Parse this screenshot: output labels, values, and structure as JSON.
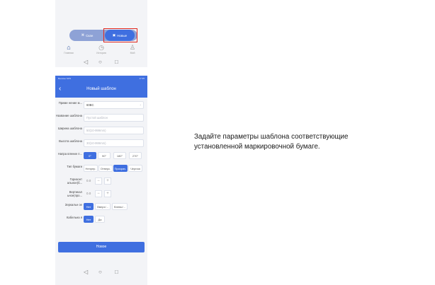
{
  "top_screen": {
    "segments": [
      {
        "label": "Скан",
        "icon": "scan-icon"
      },
      {
        "label": "Новые",
        "icon": "new-template-icon"
      }
    ],
    "tabs": [
      {
        "label": "Главная",
        "icon": "home-icon"
      },
      {
        "label": "История",
        "icon": "clock-icon"
      },
      {
        "label": "Мой",
        "icon": "user-icon"
      }
    ],
    "nav": {
      "back": "◁",
      "home": "○",
      "recent": "□"
    },
    "highlight_color": "#e0261c"
  },
  "main_screen": {
    "status_left": "Вызовы SOS",
    "status_right": "17:35",
    "title": "Новый шаблон",
    "back_glyph": "‹",
    "fields": {
      "name_example": {
        "label": "Приме нение м...",
        "value": "60BC"
      },
      "template_name": {
        "label": "Название шаблона",
        "placeholder": "Пустой шаблон"
      },
      "width": {
        "label": "Ширина шаблона",
        "placeholder": "50(10-999mm)"
      },
      "height": {
        "label": "Высота шаблона",
        "placeholder": "30(10-999mm)"
      }
    },
    "direction": {
      "label": "Напра вление п...",
      "options": [
        "0°",
        "90°",
        "180°",
        "270°"
      ],
      "selected": 0
    },
    "paper_type": {
      "label": "Тип бумаги",
      "options": [
        "Непрер.",
        "Отверс.",
        "Прозрач.",
        "Черная"
      ],
      "selected": 2
    },
    "horizontal": {
      "label": "Горизонт альное(б...",
      "value": "0.0",
      "minus": "−",
      "plus": "+"
    },
    "vertical": {
      "label": "Вертикал ьное(про...",
      "value": "0.0",
      "minus": "−",
      "plus": "+"
    },
    "mirror": {
      "label": "Зеркальн ое",
      "options": [
        "Нет",
        "Вверх/...",
        "Влево/..."
      ],
      "selected": 0
    },
    "cable": {
      "label": "Кабельна я",
      "options": [
        "Нет",
        "Да"
      ],
      "selected": 0
    },
    "new_button": "Новое",
    "nav": {
      "back": "◁",
      "home": "○",
      "recent": "□"
    },
    "accent_color": "#3f6fe0"
  },
  "caption": {
    "line1": "Задайте параметры шаблона соответствующие",
    "line2": "установленной маркировочной бумаге."
  }
}
